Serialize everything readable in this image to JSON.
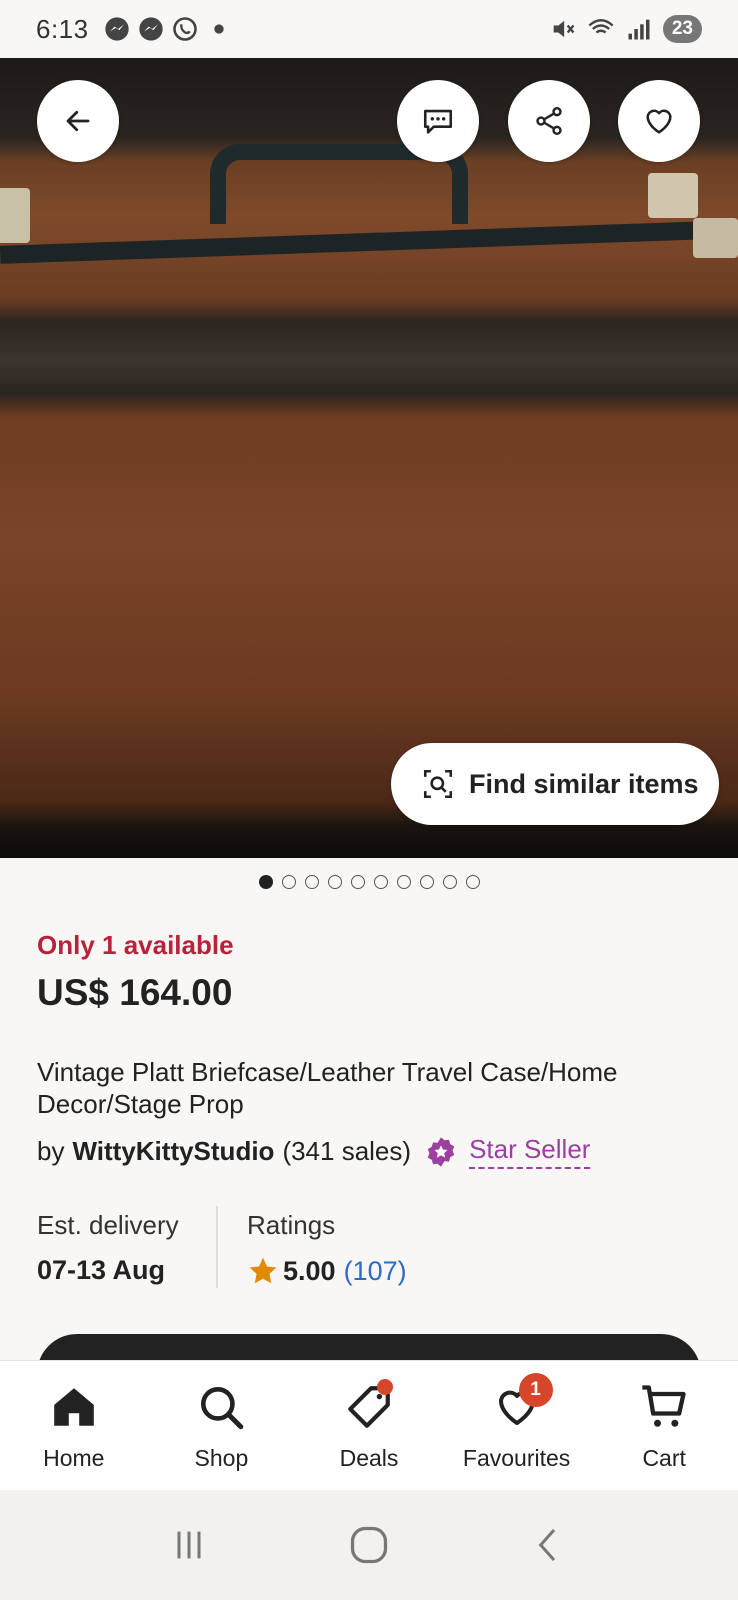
{
  "status_bar": {
    "time": "6:13",
    "battery": "23",
    "left_icons": [
      "messenger-icon",
      "messenger-icon",
      "whatsapp-icon",
      "dot-icon"
    ],
    "right_icons": [
      "mute-icon",
      "wifi-icon",
      "signal-icon"
    ]
  },
  "hero": {
    "find_similar_label": "Find similar items",
    "image_count": 10,
    "active_image": 1
  },
  "listing": {
    "availability": "Only 1 available",
    "price": "US$ 164.00",
    "title": "Vintage Platt Briefcase/Leather Travel Case/Home Decor/Stage Prop",
    "by_label": "by",
    "seller_name": "WittyKittyStudio",
    "seller_sales": "(341 sales)",
    "star_seller_label": "Star Seller"
  },
  "delivery": {
    "label": "Est. delivery",
    "value": "07-13 Aug"
  },
  "ratings": {
    "label": "Ratings",
    "value": "5.00",
    "count": "(107)"
  },
  "nav": {
    "items": [
      {
        "label": "Home",
        "icon": "home-icon"
      },
      {
        "label": "Shop",
        "icon": "search-icon"
      },
      {
        "label": "Deals",
        "icon": "tag-icon"
      },
      {
        "label": "Favourites",
        "icon": "heart-icon",
        "badge": "1"
      },
      {
        "label": "Cart",
        "icon": "cart-icon"
      }
    ]
  },
  "colors": {
    "availability": "#b8223a",
    "star_seller": "#9c3fa0",
    "rating_count": "#2f6bc4",
    "badge": "#d6462a"
  }
}
